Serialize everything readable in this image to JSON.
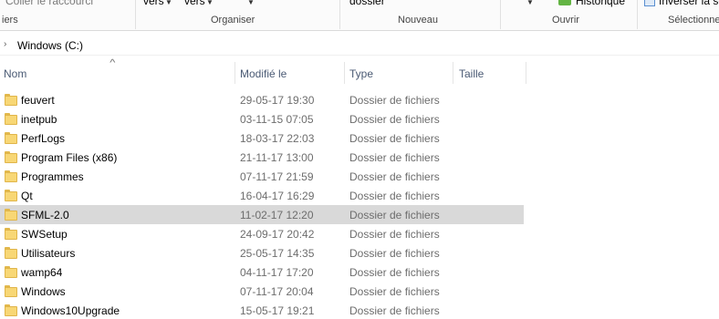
{
  "ribbon": {
    "paste_shortcut": "Coller le raccourci",
    "move_to": "vers",
    "copy_to": "vers",
    "new_folder": "dossier",
    "history": "Historique",
    "invert_selection": "Inverser la sé",
    "groups": {
      "clipboard": "iers",
      "organize": "Organiser",
      "new": "Nouveau",
      "open": "Ouvrir",
      "select": "Sélectionne"
    }
  },
  "address": {
    "path": "Windows (C:)"
  },
  "columns": {
    "name": "Nom",
    "modified": "Modifié le",
    "type": "Type",
    "size": "Taille"
  },
  "files": [
    {
      "name": "feuvert",
      "date": "29-05-17 19:30",
      "type": "Dossier de fichiers"
    },
    {
      "name": "inetpub",
      "date": "03-11-15 07:05",
      "type": "Dossier de fichiers"
    },
    {
      "name": "PerfLogs",
      "date": "18-03-17 22:03",
      "type": "Dossier de fichiers"
    },
    {
      "name": "Program Files (x86)",
      "date": "21-11-17 13:00",
      "type": "Dossier de fichiers"
    },
    {
      "name": "Programmes",
      "date": "07-11-17 21:59",
      "type": "Dossier de fichiers"
    },
    {
      "name": "Qt",
      "date": "16-04-17 16:29",
      "type": "Dossier de fichiers"
    },
    {
      "name": "SFML-2.0",
      "date": "11-02-17 12:20",
      "type": "Dossier de fichiers",
      "selected": true
    },
    {
      "name": "SWSetup",
      "date": "24-09-17 20:42",
      "type": "Dossier de fichiers"
    },
    {
      "name": "Utilisateurs",
      "date": "25-05-17 14:35",
      "type": "Dossier de fichiers"
    },
    {
      "name": "wamp64",
      "date": "04-11-17 17:20",
      "type": "Dossier de fichiers"
    },
    {
      "name": "Windows",
      "date": "07-11-17 20:04",
      "type": "Dossier de fichiers"
    },
    {
      "name": "Windows10Upgrade",
      "date": "15-05-17 19:21",
      "type": "Dossier de fichiers"
    }
  ],
  "colors": {
    "selected_row": "#d9d9d9",
    "folder": "#f8d775",
    "header_text": "#4a5a74",
    "secondary_text": "#6d6d6d"
  },
  "icons": {
    "folder": "folder-icon",
    "sort": "sort-ascending-icon",
    "address_chevron": "chevron-right-icon",
    "history": "history-icon",
    "invert_selection": "checkbox-icon"
  }
}
